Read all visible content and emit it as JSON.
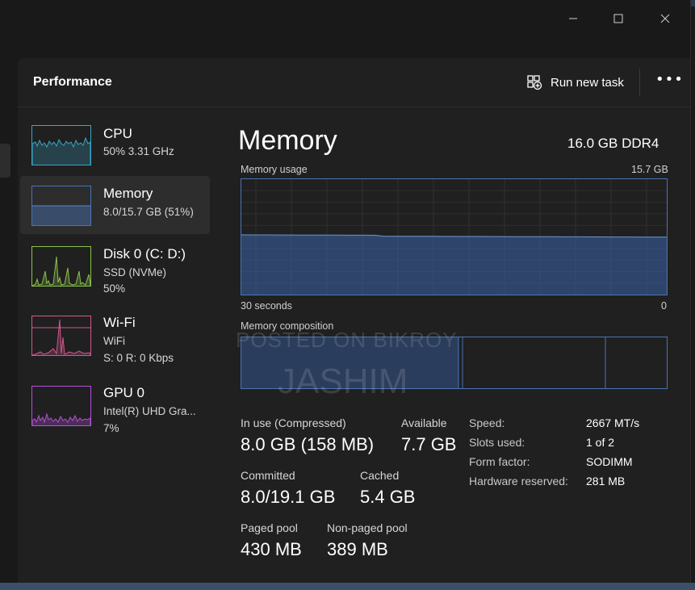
{
  "header": {
    "title": "Performance",
    "run_task_label": "Run new task",
    "more_label": "•••"
  },
  "sidebar": {
    "items": [
      {
        "name": "CPU",
        "sub1": "50%  3.31 GHz",
        "sub2": ""
      },
      {
        "name": "Memory",
        "sub1": "8.0/15.7 GB (51%)",
        "sub2": ""
      },
      {
        "name": "Disk 0 (C: D:)",
        "sub1": "SSD (NVMe)",
        "sub2": "50%"
      },
      {
        "name": "Wi-Fi",
        "sub1": "WiFi",
        "sub2": "S: 0  R: 0 Kbps"
      },
      {
        "name": "GPU 0",
        "sub1": "Intel(R) UHD Gra...",
        "sub2": "7%"
      }
    ]
  },
  "main": {
    "title": "Memory",
    "spec": "16.0 GB DDR4",
    "usage_label": "Memory usage",
    "usage_max": "15.7 GB",
    "time_label": "30 seconds",
    "zero_label": "0",
    "composition_label": "Memory composition",
    "usage_fraction": 0.51
  },
  "stats": {
    "in_use_label": "In use (Compressed)",
    "in_use_value": "8.0 GB (158 MB)",
    "available_label": "Available",
    "available_value": "7.7 GB",
    "committed_label": "Committed",
    "committed_value": "8.0/19.1 GB",
    "cached_label": "Cached",
    "cached_value": "5.4 GB",
    "paged_label": "Paged pool",
    "paged_value": "430 MB",
    "nonpaged_label": "Non-paged pool",
    "nonpaged_value": "389 MB"
  },
  "details": [
    {
      "label": "Speed:",
      "value": "2667 MT/s"
    },
    {
      "label": "Slots used:",
      "value": "1 of 2"
    },
    {
      "label": "Form factor:",
      "value": "SODIMM"
    },
    {
      "label": "Hardware reserved:",
      "value": "281 MB"
    }
  ],
  "watermark": {
    "line1": "POSTED ON BIKROY",
    "line2": "JASHIM"
  },
  "colors": {
    "memory": "#4a74b3",
    "cpu": "#3aa6c9",
    "disk": "#8bc34a",
    "wifi": "#d4578f",
    "gpu": "#b44fd6"
  }
}
